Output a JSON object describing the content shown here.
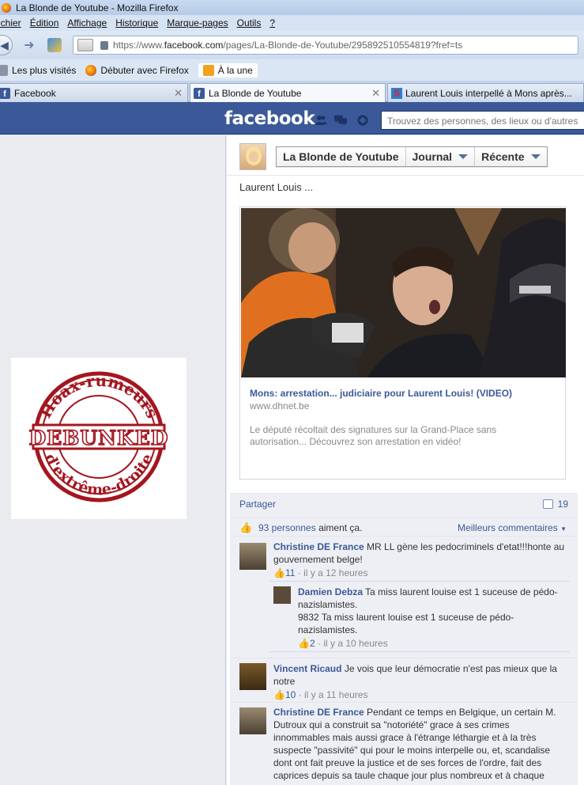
{
  "window": {
    "title": "La Blonde de Youtube - Mozilla Firefox"
  },
  "menu": [
    "ichier",
    "Édition",
    "Affichage",
    "Historique",
    "Marque-pages",
    "Outils",
    "?"
  ],
  "address": {
    "prefix": "https://www.",
    "domain": "facebook.com",
    "path": "/pages/La-Blonde-de-Youtube/295892510554819?fref=ts"
  },
  "bookmarks": [
    "Les plus visités",
    "Débuter avec Firefox",
    "À la une"
  ],
  "tabs": [
    {
      "label": "Facebook"
    },
    {
      "label": "La Blonde de Youtube"
    },
    {
      "label": "Laurent Louis interpellé à Mons après..."
    }
  ],
  "fb": {
    "logo": "facebook",
    "search_placeholder": "Trouvez des personnes, des lieux ou d'autres"
  },
  "badge": {
    "top_text": "Hoax-rumeurs",
    "center_text": "DEBUNKED",
    "bottom_text": "d'extrême-droite",
    "color": "#a4161f"
  },
  "page": {
    "name": "La Blonde de Youtube",
    "journal": "Journal",
    "recent": "Récente"
  },
  "post": {
    "text": "Laurent Louis ...",
    "link_title": "Mons: arrestation... judiciaire pour Laurent Louis! (VIDEO)",
    "link_domain": "www.dhnet.be",
    "link_desc": "Le député récoltait des signatures sur la Grand-Place sans autorisation... Découvrez son arrestation en vidéo!",
    "share_label": "Partager",
    "share_count": "19",
    "likes_link": "93 personnes",
    "likes_suffix": " aiment ça.",
    "best_comments": "Meilleurs commentaires"
  },
  "comments": [
    {
      "author": "Christine DE France",
      "text": "MR LL gène les pedocriminels d'etat!!!honte au gouvernement belge!",
      "likes": "11",
      "time": "il y a 12 heures"
    },
    {
      "author": "Vincent Ricaud",
      "text": "Je vois que leur démocratie n'est pas mieux que la notre",
      "likes": "10",
      "time": "il y a 11 heures"
    },
    {
      "author": "Christine DE France",
      "text": "Pendant ce temps en Belgique, un certain M. Dutroux qui a construit sa \"notoriété\" grace à ses crimes innommables mais aussi grace à l'étrange léthargie et à la très suspecte \"passivité\" qui pour le moins interpelle ou, et, scandalise dont ont fait preuve la justice et de ses forces de l'ordre, fait des caprices depuis sa taule chaque jour plus nombreux et à chaque"
    }
  ],
  "reply": {
    "author": "Damien Debza",
    "text1": "Ta miss laurent louise est 1 suceuse de pédo-nazislamistes.",
    "text2": "9832 Ta miss laurent louise est 1 suceuse de pédo-nazislamistes.",
    "likes": "2",
    "time": "il y a 10 heures"
  },
  "colors": {
    "fb_blue": "#3b5998",
    "link": "#3b5998",
    "badge_red": "#a4161f"
  }
}
